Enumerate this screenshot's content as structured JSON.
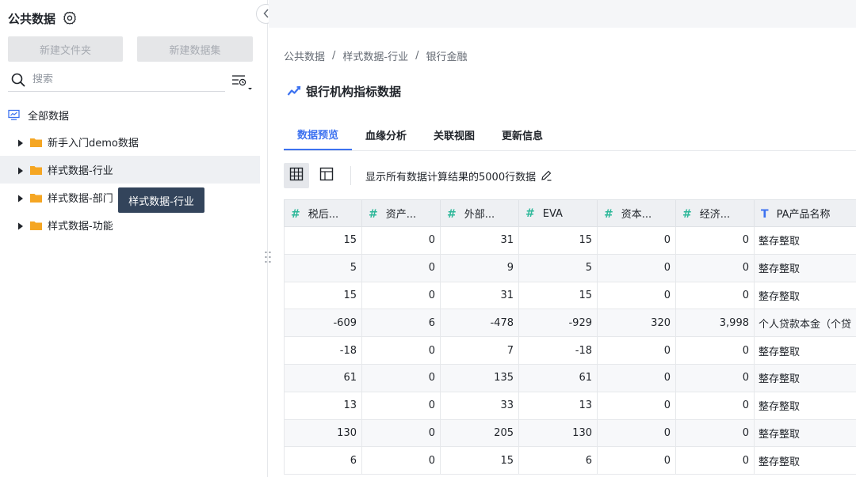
{
  "sidebar": {
    "title": "公共数据",
    "new_folder_label": "新建文件夹",
    "new_dataset_label": "新建数据集",
    "search_placeholder": "搜索",
    "root_label": "全部数据",
    "items": [
      {
        "label": "新手入门demo数据"
      },
      {
        "label": "样式数据-行业"
      },
      {
        "label": "样式数据-部门"
      },
      {
        "label": "样式数据-功能"
      }
    ],
    "tooltip": "样式数据-行业"
  },
  "breadcrumb": {
    "items": [
      "公共数据",
      "样式数据-行业",
      "银行金融"
    ],
    "separator": "/"
  },
  "page": {
    "title": "银行机构指标数据"
  },
  "tabs": [
    {
      "label": "数据预览",
      "active": true
    },
    {
      "label": "血缘分析",
      "active": false
    },
    {
      "label": "关联视图",
      "active": false
    },
    {
      "label": "更新信息",
      "active": false
    }
  ],
  "toolbar": {
    "info_text": "显示所有数据计算结果的5000行数据"
  },
  "table": {
    "columns": [
      {
        "label": "税后...",
        "type": "#"
      },
      {
        "label": "资产...",
        "type": "#"
      },
      {
        "label": "外部...",
        "type": "#"
      },
      {
        "label": "EVA",
        "type": "#"
      },
      {
        "label": "资本...",
        "type": "#"
      },
      {
        "label": "经济...",
        "type": "#"
      },
      {
        "label": "PA产品名称",
        "type": "T"
      }
    ],
    "rows": [
      [
        "15",
        "0",
        "31",
        "15",
        "0",
        "0",
        "整存整取"
      ],
      [
        "5",
        "0",
        "9",
        "5",
        "0",
        "0",
        "整存整取"
      ],
      [
        "15",
        "0",
        "31",
        "15",
        "0",
        "0",
        "整存整取"
      ],
      [
        "-609",
        "6",
        "-478",
        "-929",
        "320",
        "3,998",
        "个人贷款本金（个贷"
      ],
      [
        "-18",
        "0",
        "7",
        "-18",
        "0",
        "0",
        "整存整取"
      ],
      [
        "61",
        "0",
        "135",
        "61",
        "0",
        "0",
        "整存整取"
      ],
      [
        "13",
        "0",
        "33",
        "13",
        "0",
        "0",
        "整存整取"
      ],
      [
        "130",
        "0",
        "205",
        "130",
        "0",
        "0",
        "整存整取"
      ],
      [
        "6",
        "0",
        "15",
        "6",
        "0",
        "0",
        "整存整取"
      ]
    ]
  },
  "colors": {
    "accent": "#3d72f0",
    "number_type": "#2fb89a",
    "tooltip_bg": "#33445b",
    "folder": "#f5a623"
  }
}
